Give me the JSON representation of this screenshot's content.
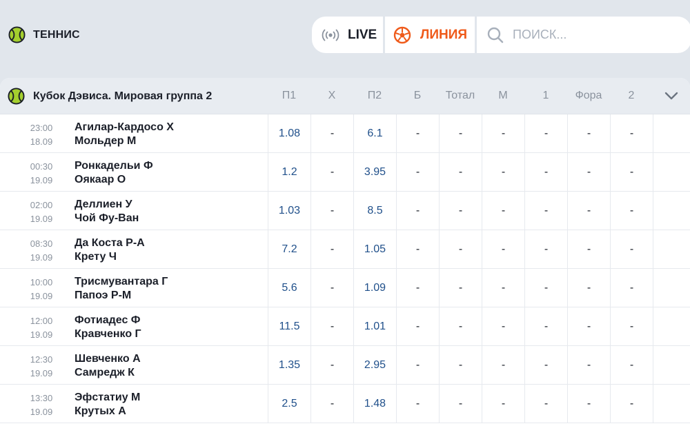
{
  "header": {
    "sport_name": "ТЕННИС",
    "live_label": "LIVE",
    "line_label": "ЛИНИЯ",
    "search_placeholder": "ПОИСК..."
  },
  "colors": {
    "accent_orange": "#ef5a1a",
    "odds_blue": "#1f4f8a",
    "tennis_ball": "#a4cf2e",
    "background": "#e1e6ec"
  },
  "league": {
    "title": "Кубок Дэвиса. Мировая группа 2",
    "columns": [
      "П1",
      "Х",
      "П2",
      "Б",
      "Тотал",
      "М",
      "1",
      "Фора",
      "2"
    ]
  },
  "matches": [
    {
      "time": "23:00",
      "date": "18.09",
      "player1": "Агилар-Кардосо Х",
      "player2": "Мольдер М",
      "odds": [
        "1.08",
        "-",
        "6.1",
        "-",
        "-",
        "-",
        "-",
        "-",
        "-"
      ]
    },
    {
      "time": "00:30",
      "date": "19.09",
      "player1": "Ронкадельи Ф",
      "player2": "Оякаар О",
      "odds": [
        "1.2",
        "-",
        "3.95",
        "-",
        "-",
        "-",
        "-",
        "-",
        "-"
      ]
    },
    {
      "time": "02:00",
      "date": "19.09",
      "player1": "Деллиен У",
      "player2": "Чой Фу-Ван",
      "odds": [
        "1.03",
        "-",
        "8.5",
        "-",
        "-",
        "-",
        "-",
        "-",
        "-"
      ]
    },
    {
      "time": "08:30",
      "date": "19.09",
      "player1": "Да Коста Р-А",
      "player2": "Крету Ч",
      "odds": [
        "7.2",
        "-",
        "1.05",
        "-",
        "-",
        "-",
        "-",
        "-",
        "-"
      ]
    },
    {
      "time": "10:00",
      "date": "19.09",
      "player1": "Трисмувантара Г",
      "player2": "Папоэ Р-М",
      "odds": [
        "5.6",
        "-",
        "1.09",
        "-",
        "-",
        "-",
        "-",
        "-",
        "-"
      ]
    },
    {
      "time": "12:00",
      "date": "19.09",
      "player1": "Фотиадес Ф",
      "player2": "Кравченко Г",
      "odds": [
        "11.5",
        "-",
        "1.01",
        "-",
        "-",
        "-",
        "-",
        "-",
        "-"
      ]
    },
    {
      "time": "12:30",
      "date": "19.09",
      "player1": "Шевченко А",
      "player2": "Самредж К",
      "odds": [
        "1.35",
        "-",
        "2.95",
        "-",
        "-",
        "-",
        "-",
        "-",
        "-"
      ]
    },
    {
      "time": "13:30",
      "date": "19.09",
      "player1": "Эфстатиу М",
      "player2": "Крутых А",
      "odds": [
        "2.5",
        "-",
        "1.48",
        "-",
        "-",
        "-",
        "-",
        "-",
        "-"
      ]
    }
  ]
}
